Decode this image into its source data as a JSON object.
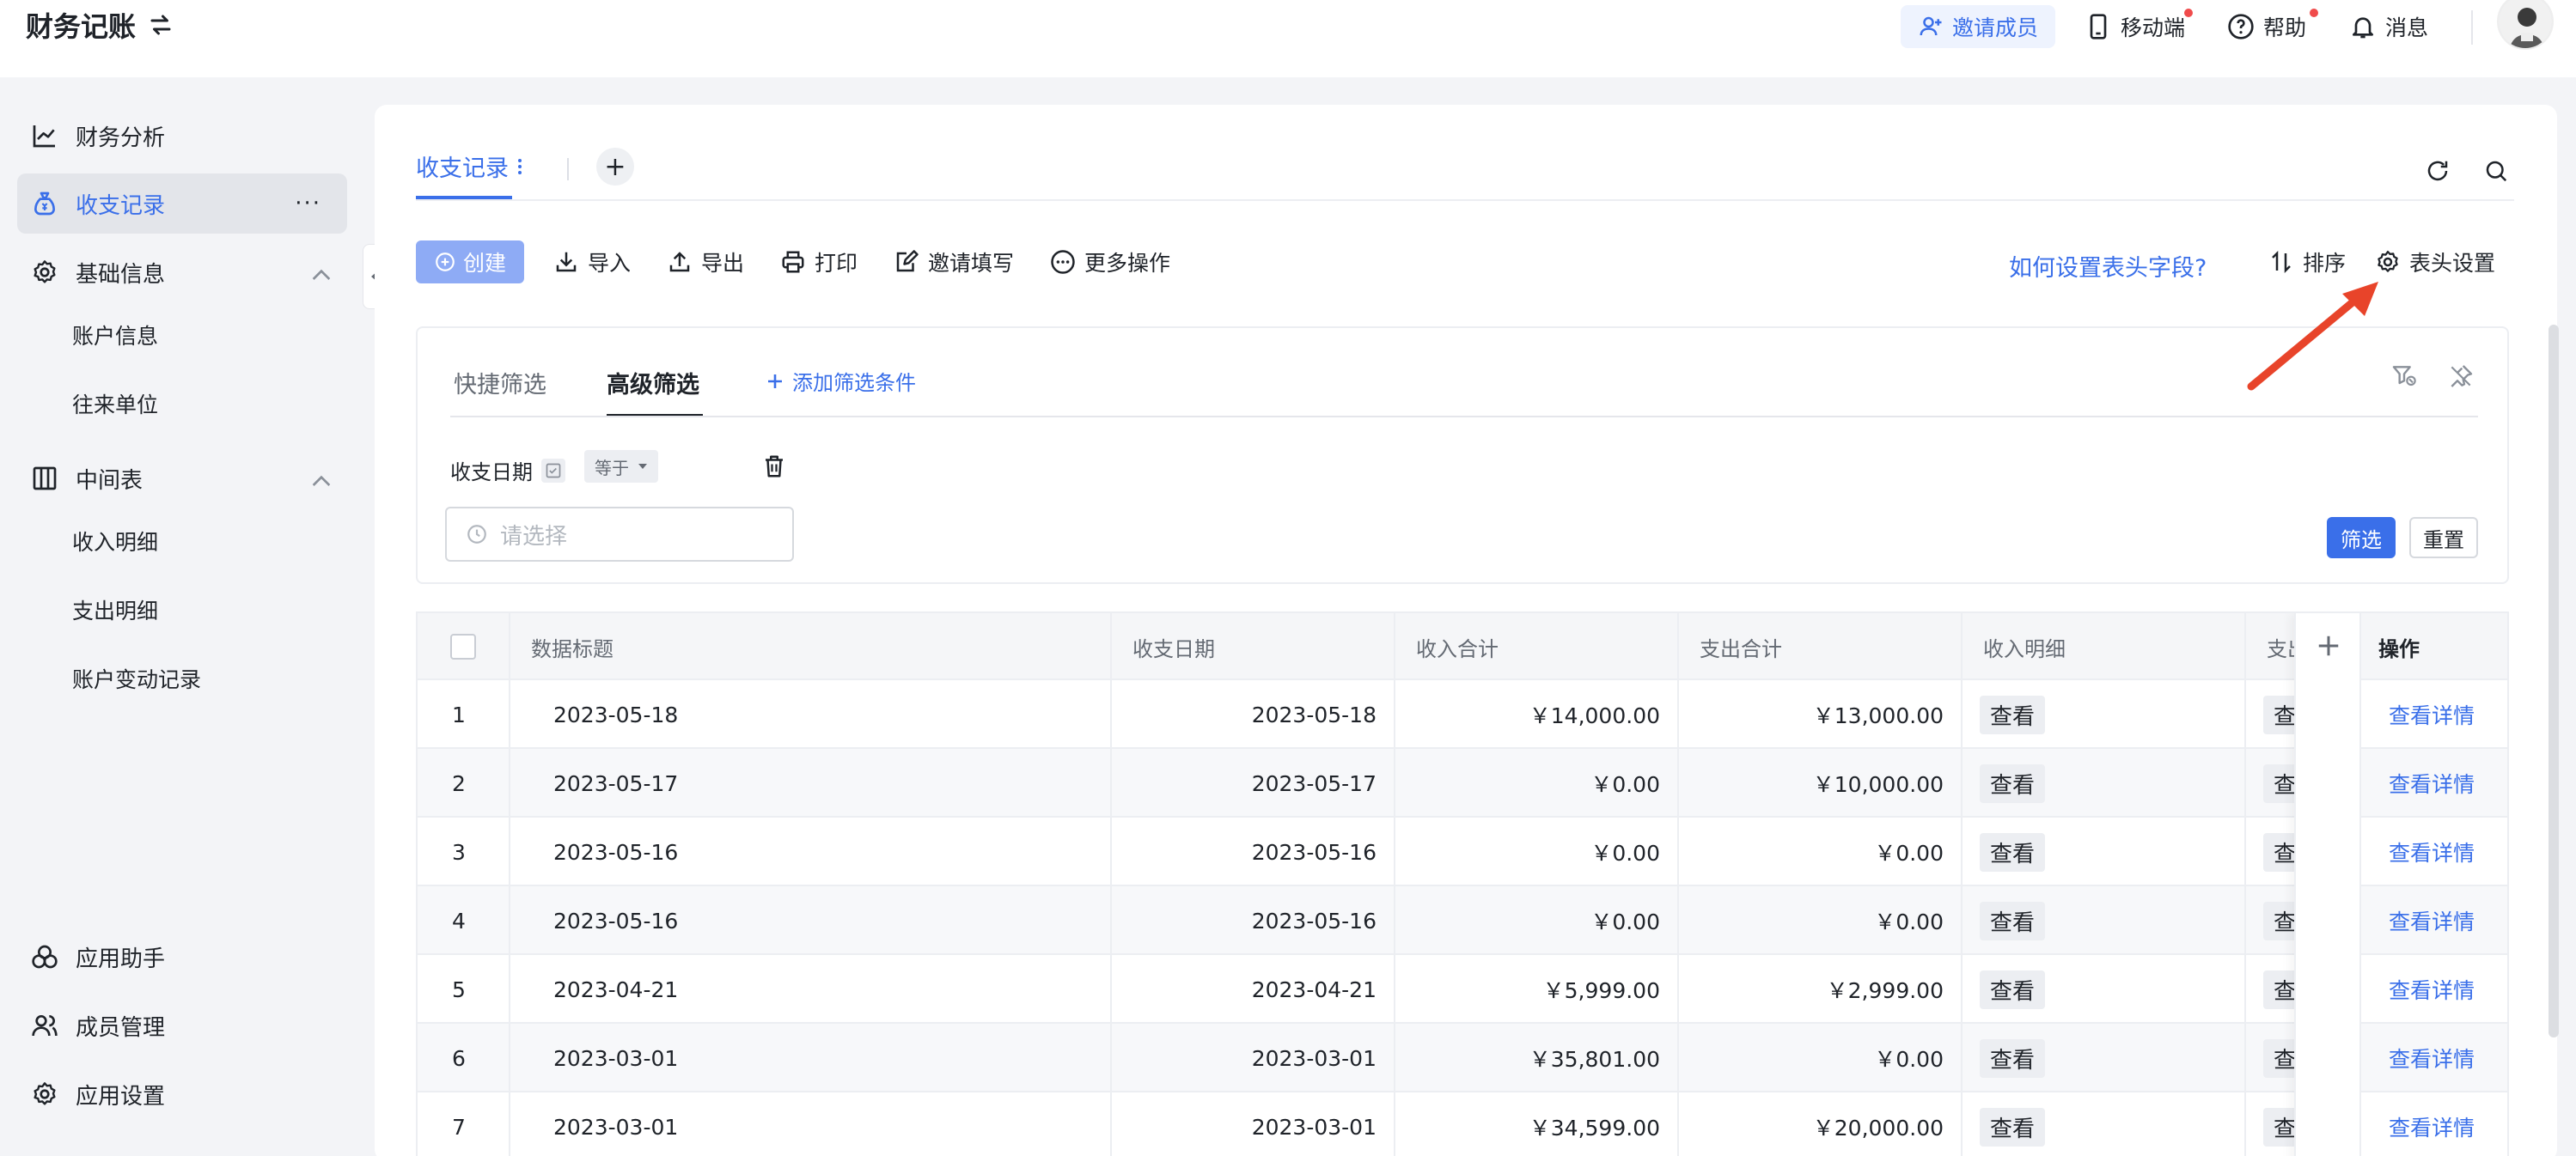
{
  "app": {
    "title": "财务记账",
    "swap_icon": "swap-icon"
  },
  "topbar": {
    "invite_label": "邀请成员",
    "mobile_label": "移动端",
    "help_label": "帮助",
    "messages_label": "消息"
  },
  "sidebar": {
    "items": [
      {
        "label": "财务分析",
        "icon": "chart-line-icon"
      },
      {
        "label": "收支记录",
        "icon": "money-bag-icon",
        "more": "···"
      },
      {
        "label": "基础信息",
        "icon": "gear-icon"
      },
      {
        "label": "中间表",
        "icon": "table-icon"
      }
    ],
    "basic_sub": [
      "账户信息",
      "往来单位"
    ],
    "middle_sub": [
      "收入明细",
      "支出明细",
      "账户变动记录"
    ],
    "bottom": [
      {
        "label": "应用助手",
        "icon": "assistant-icon"
      },
      {
        "label": "成员管理",
        "icon": "members-icon"
      },
      {
        "label": "应用设置",
        "icon": "gear-icon"
      }
    ]
  },
  "tabs": {
    "active_label": "收支记录",
    "add_label": "+"
  },
  "toolbar": {
    "create_label": "创建",
    "import_label": "导入",
    "export_label": "导出",
    "print_label": "打印",
    "invite_fill_label": "邀请填写",
    "more_label": "更多操作",
    "help_link": "如何设置表头字段?",
    "sort_label": "排序",
    "header_settings_label": "表头设置"
  },
  "filter": {
    "tab_quick": "快捷筛选",
    "tab_advanced": "高级筛选",
    "add_condition": "添加筛选条件",
    "field_label": "收支日期",
    "operator": "等于",
    "date_placeholder": "请选择",
    "filter_button": "筛选",
    "reset_button": "重置"
  },
  "table": {
    "columns": [
      "数据标题",
      "收支日期",
      "收入合计",
      "支出合计",
      "收入明细",
      "支出",
      "操作"
    ],
    "view_label": "查看",
    "view_clipped": "查",
    "detail_label": "查看详情",
    "rows": [
      {
        "no": "1",
        "title": "2023-05-18",
        "date": "2023-05-18",
        "income": "￥14,000.00",
        "expense": "￥13,000.00"
      },
      {
        "no": "2",
        "title": "2023-05-17",
        "date": "2023-05-17",
        "income": "￥0.00",
        "expense": "￥10,000.00"
      },
      {
        "no": "3",
        "title": "2023-05-16",
        "date": "2023-05-16",
        "income": "￥0.00",
        "expense": "￥0.00"
      },
      {
        "no": "4",
        "title": "2023-05-16",
        "date": "2023-05-16",
        "income": "￥0.00",
        "expense": "￥0.00"
      },
      {
        "no": "5",
        "title": "2023-04-21",
        "date": "2023-04-21",
        "income": "￥5,999.00",
        "expense": "￥2,999.00"
      },
      {
        "no": "6",
        "title": "2023-03-01",
        "date": "2023-03-01",
        "income": "￥35,801.00",
        "expense": "￥0.00"
      },
      {
        "no": "7",
        "title": "2023-03-01",
        "date": "2023-03-01",
        "income": "￥34,599.00",
        "expense": "￥20,000.00"
      }
    ]
  },
  "colors": {
    "accent": "#3a6fe9",
    "create_button": "#8eabf5",
    "notification_dot": "#f04b4b",
    "annotation_arrow": "#e8442a"
  }
}
